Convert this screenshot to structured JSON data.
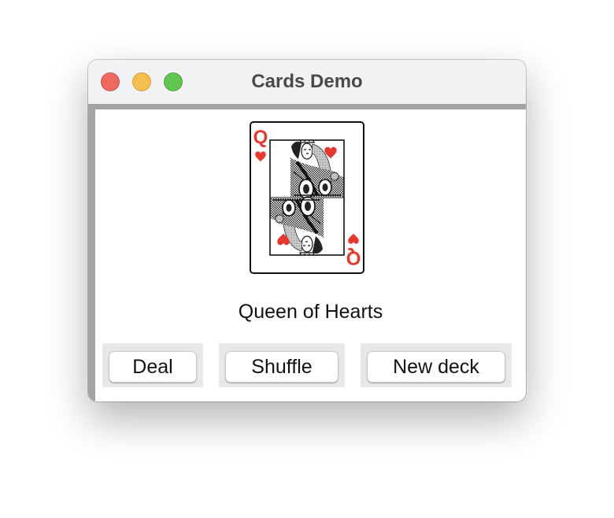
{
  "window": {
    "title": "Cards Demo"
  },
  "card": {
    "rank": "Q",
    "suit": "Hearts",
    "suit_color": "#e8372d",
    "caption": "Queen of Hearts"
  },
  "buttons": {
    "deal": "Deal",
    "shuffle": "Shuffle",
    "new_deck": "New deck"
  },
  "colors": {
    "close": "#ec6a5e",
    "minimize": "#f4bf4f",
    "zoom": "#61c554"
  }
}
